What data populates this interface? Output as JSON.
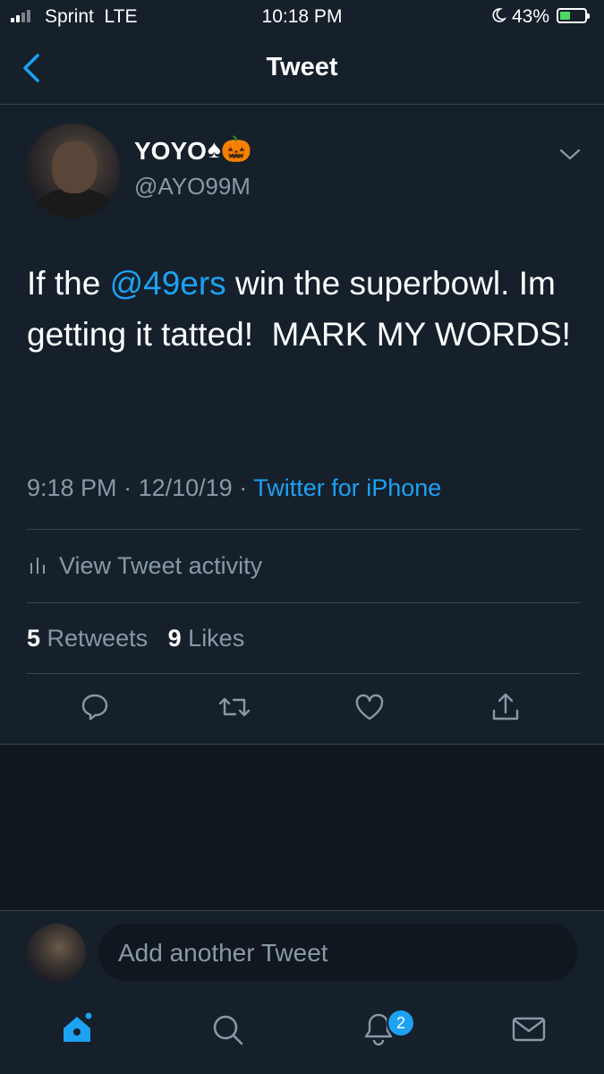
{
  "status_bar": {
    "carrier": "Sprint  LTE",
    "time": "10:18 PM",
    "battery_percent": "43%",
    "battery_level": 0.43
  },
  "header": {
    "title": "Tweet",
    "back_icon": "chevron-left-icon"
  },
  "tweet": {
    "display_name": "YOYO",
    "name_emojis": "♠🎃",
    "handle": "@AYO99M",
    "text_parts": {
      "before": "If the ",
      "mention": "@49ers",
      "after": " win the superbowl. Im getting it tatted!  MARK MY WORDS!"
    },
    "time": "9:18 PM",
    "date": "12/10/19",
    "source": "Twitter for iPhone",
    "activity_label": "View Tweet activity",
    "retweet_count": "5",
    "retweet_label": "Retweets",
    "like_count": "9",
    "like_label": "Likes"
  },
  "reply": {
    "placeholder": "Add another Tweet"
  },
  "tab_bar": {
    "notifications_badge": "2"
  },
  "colors": {
    "background": "#15202b",
    "accent": "#1da1f2",
    "muted": "#8899a6",
    "divider": "#38444d"
  }
}
